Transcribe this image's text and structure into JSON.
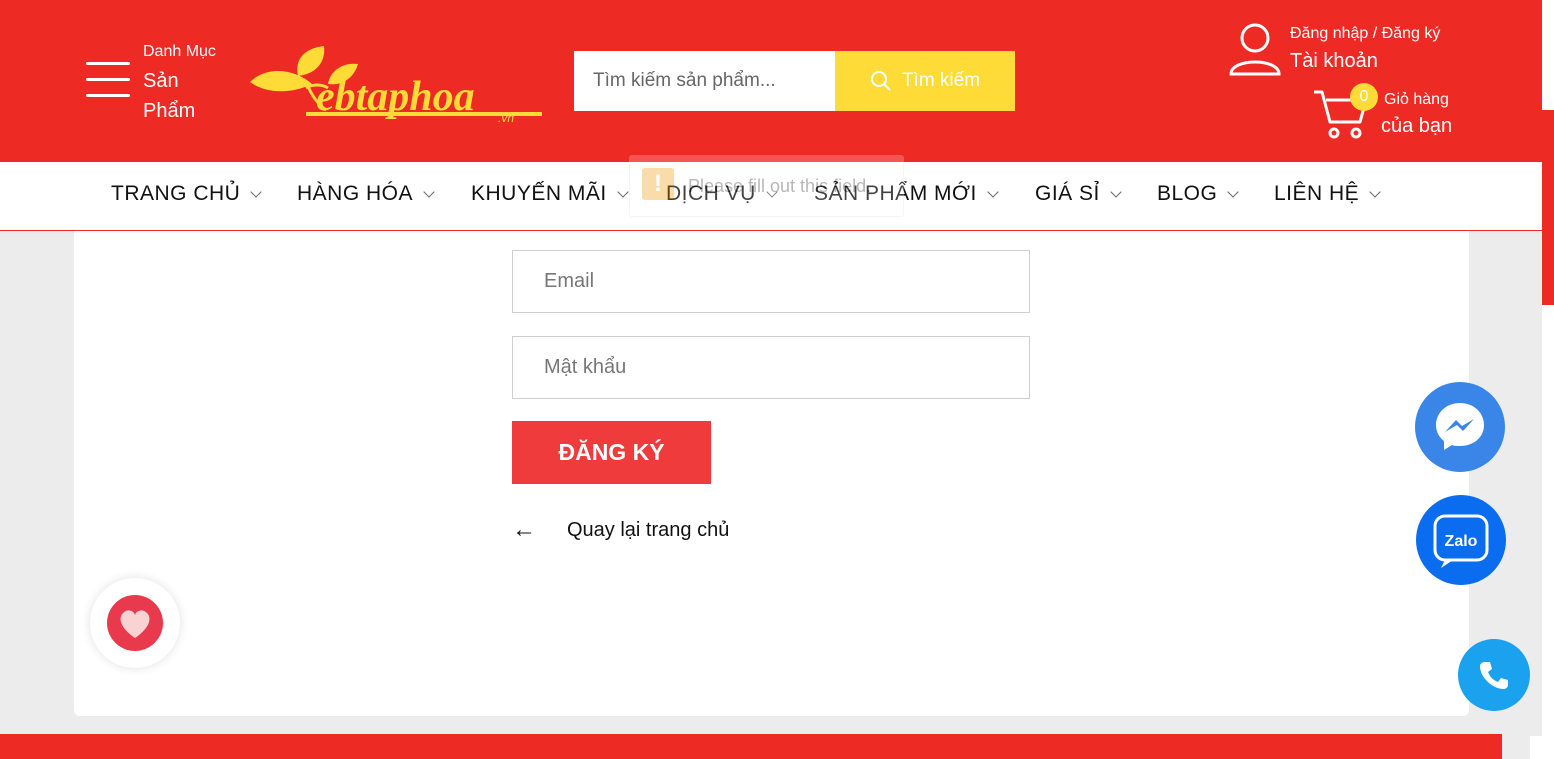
{
  "header": {
    "category_small": "Danh Mục",
    "category_big": "Sản Phẩm",
    "logo_text": "ebtaphoa",
    "logo_suffix": ".vn",
    "search_placeholder": "Tìm kiếm sản phẩm...",
    "search_button": "Tìm kiếm",
    "account_small": "Đăng nhập / Đăng ký",
    "account_big": "Tài khoản",
    "cart_count": "0",
    "cart_small": "Giỏ hàng",
    "cart_big": "của bạn"
  },
  "nav": {
    "items": [
      {
        "label": "TRANG CHỦ"
      },
      {
        "label": "HÀNG HÓA"
      },
      {
        "label": "KHUYẾN MÃI"
      },
      {
        "label": "DỊCH VỤ"
      },
      {
        "label": "SẢN PHẨM MỚI"
      },
      {
        "label": "GIÁ SỈ"
      },
      {
        "label": "BLOG"
      },
      {
        "label": "LIÊN HỆ"
      }
    ]
  },
  "tooltip": {
    "icon": "!",
    "text": "Please fill out this field."
  },
  "form": {
    "email_placeholder": "Email",
    "password_placeholder": "Mật khẩu",
    "submit_label": "ĐĂNG KÝ",
    "back_arrow": "←",
    "back_label": "Quay lại trang chủ"
  },
  "floating": {
    "zalo_label": "Zalo"
  },
  "colors": {
    "brand_red": "#ee2a25",
    "accent_yellow": "#fedb37",
    "button_red": "#ef3b3b",
    "messenger_blue": "#3a86e8",
    "zalo_blue": "#0a6df0",
    "phone_blue": "#1aa2ef"
  },
  "icons": [
    "hamburger-icon",
    "search-icon",
    "user-icon",
    "cart-icon",
    "arrow-left-icon",
    "heart-icon",
    "messenger-icon",
    "zalo-icon",
    "phone-icon",
    "warning-icon"
  ]
}
